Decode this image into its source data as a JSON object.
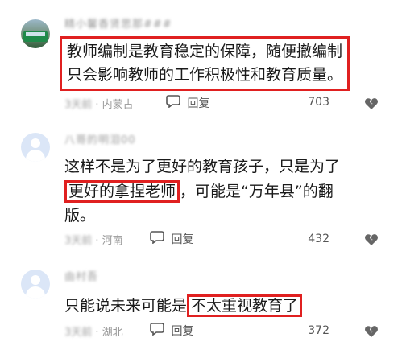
{
  "comments": [
    {
      "username": "精小馨香贤思那###",
      "text_line1": "教师编制是教育稳定的保障，随便撤编制",
      "text_line2": "只会影响教师的工作积极性和教育质量。",
      "time": "3天前",
      "location": "· 内蒙古",
      "reply_label": "回复",
      "likes": "703"
    },
    {
      "username": "八哥的明泪00",
      "text_line1": "这样不是为了更好的教育孩子，只是为了",
      "text_line2_highlight": "更好的拿捏老师",
      "text_line2_rest": "，可能是“万年县”的翻",
      "text_line3": "版。",
      "time": "3天前",
      "location": "· 河南",
      "reply_label": "回复",
      "likes": "432"
    },
    {
      "username": "由村吾",
      "text_plain": "只能说未来可能是",
      "text_highlight": "不太重视教育了",
      "time": "3天前",
      "location": "· 湖北",
      "reply_label": "回复",
      "likes": "372"
    }
  ],
  "icons": {
    "reply": "speech-bubble-icon",
    "dislike": "broken-heart-icon"
  },
  "colors": {
    "highlight_border": "#e02020",
    "meta_text": "#999999",
    "avatar_default": "#dbe6f7"
  }
}
